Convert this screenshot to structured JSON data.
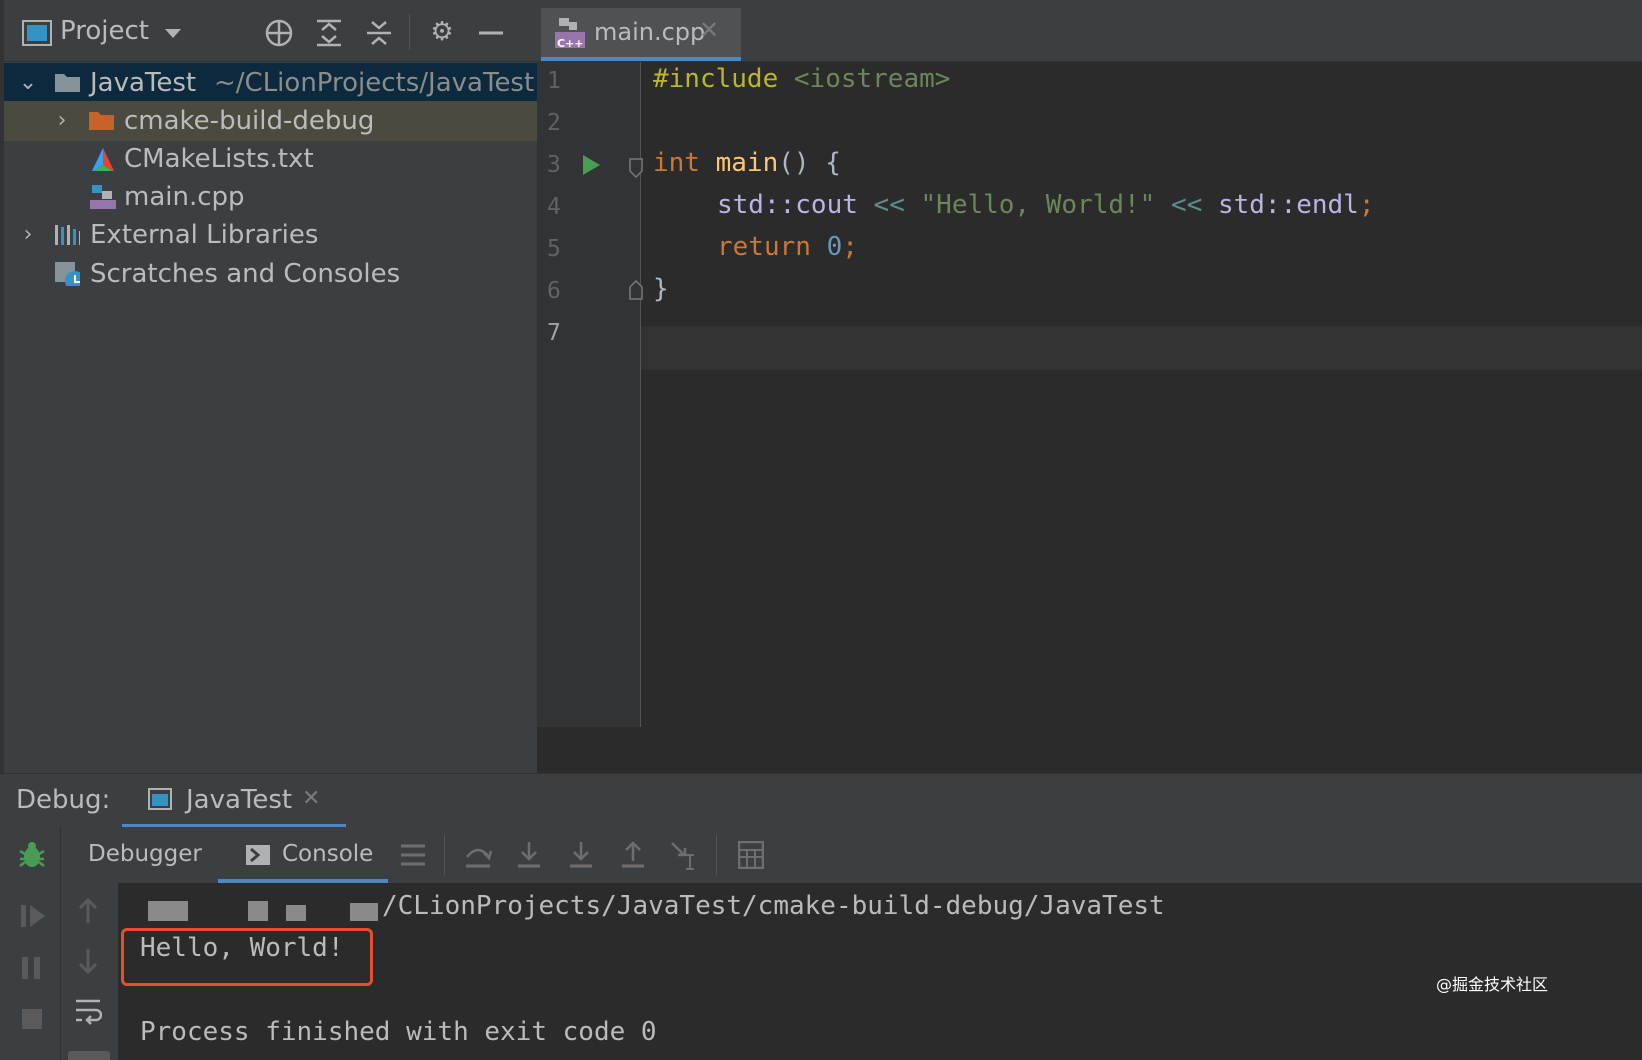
{
  "project": {
    "header_title": "Project",
    "tree": [
      {
        "name": "JavaTest",
        "path": "~/CLionProjects/JavaTest"
      },
      {
        "name": "cmake-build-debug"
      },
      {
        "name": "CMakeLists.txt"
      },
      {
        "name": "main.cpp"
      },
      {
        "name": "External Libraries"
      },
      {
        "name": "Scratches and Consoles"
      }
    ]
  },
  "editor": {
    "tab_label": "main.cpp",
    "tab_badge": "C++",
    "line_numbers": [
      "1",
      "2",
      "3",
      "4",
      "5",
      "6",
      "7"
    ],
    "code": {
      "l1_directive": "#include",
      "l1_header": "<iostream>",
      "l3_type": "int",
      "l3_name": "main",
      "l3_rest": "() {",
      "l4_ns1": "std::cout",
      "l4_op1": "<<",
      "l4_str": "\"Hello, World!\"",
      "l4_op2": "<<",
      "l4_ns2": "std::endl",
      "l4_semi": ";",
      "l5_kw": "return",
      "l5_num": "0",
      "l5_semi": ";",
      "l6_close": "}"
    }
  },
  "debug": {
    "label": "Debug:",
    "session_tab": "JavaTest",
    "tabs": [
      "Debugger",
      "Console"
    ],
    "console": {
      "path_line": "/CLionProjects/JavaTest/cmake-build-debug/JavaTest",
      "output": "Hello, World!",
      "exit": "Process finished with exit code 0"
    }
  },
  "watermark": "@掘金技术社区",
  "colors": {
    "accent": "#4a88c7",
    "highlight_box": "#e8502a",
    "run_icon": "#499c54"
  }
}
